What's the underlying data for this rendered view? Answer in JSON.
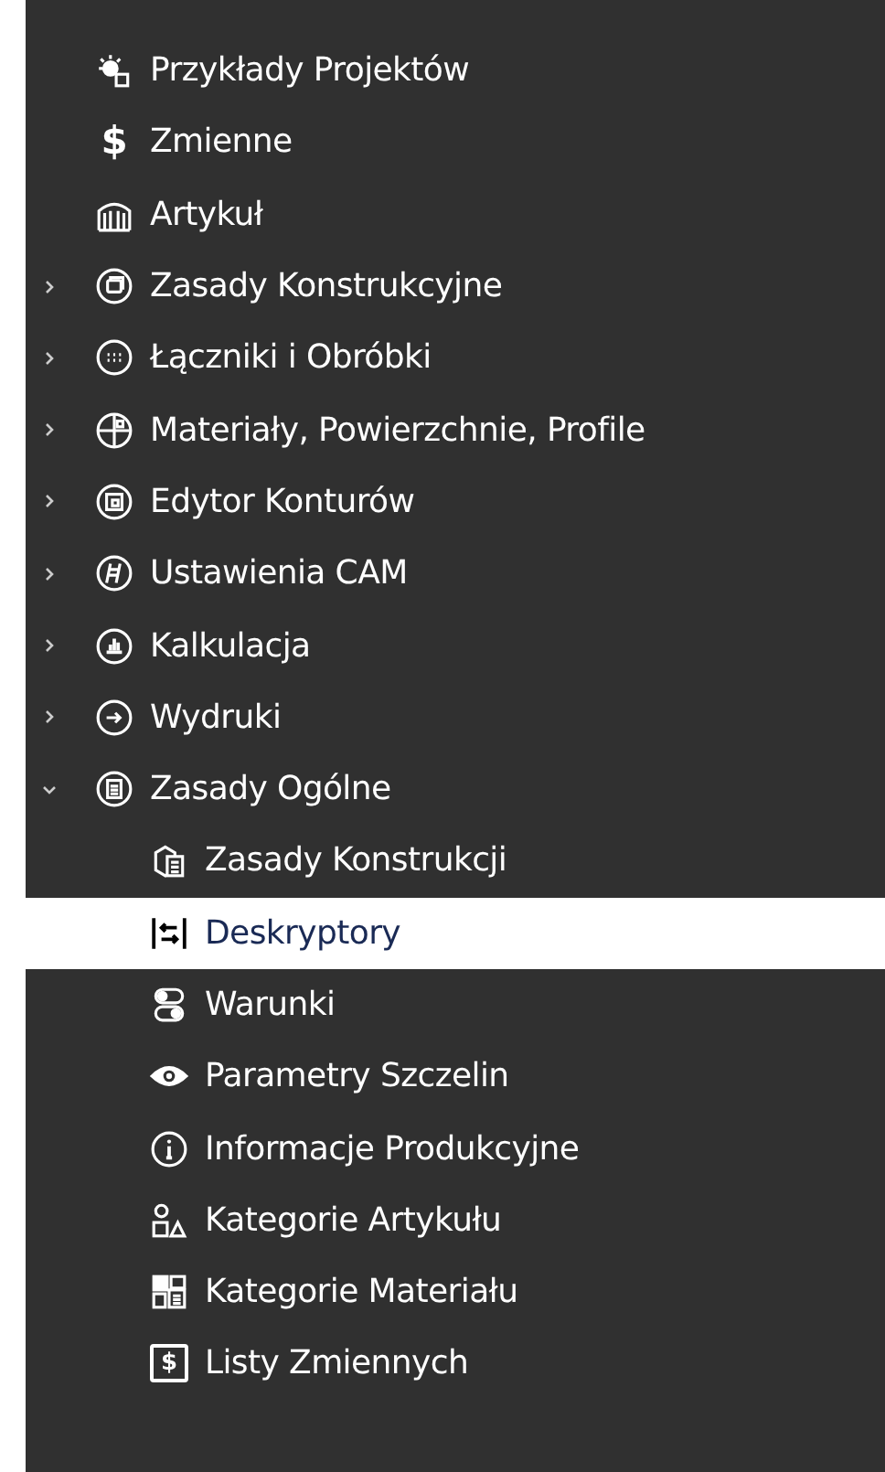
{
  "tree": [
    {
      "label": "Przykłady Projektów",
      "kind": "leaf",
      "selected": false
    },
    {
      "label": "Zmienne",
      "kind": "leaf",
      "selected": false,
      "icon_text": "$"
    },
    {
      "label": "Artykuł",
      "kind": "leaf",
      "selected": false
    },
    {
      "label": "Zasady Konstrukcyjne",
      "kind": "group",
      "expanded": false,
      "selected": false
    },
    {
      "label": "Łączniki i Obróbki",
      "kind": "group",
      "expanded": false,
      "selected": false
    },
    {
      "label": "Materiały, Powierzchnie, Profile",
      "kind": "group",
      "expanded": false,
      "selected": false
    },
    {
      "label": "Edytor Konturów",
      "kind": "group",
      "expanded": false,
      "selected": false
    },
    {
      "label": "Ustawienia CAM",
      "kind": "group",
      "expanded": false,
      "selected": false
    },
    {
      "label": "Kalkulacja",
      "kind": "group",
      "expanded": false,
      "selected": false
    },
    {
      "label": "Wydruki",
      "kind": "group",
      "expanded": false,
      "selected": false
    },
    {
      "label": "Zasady Ogólne",
      "kind": "group",
      "expanded": true,
      "selected": false,
      "children": [
        {
          "label": "Zasady Konstrukcji",
          "selected": false
        },
        {
          "label": "Deskryptory",
          "selected": true
        },
        {
          "label": "Warunki",
          "selected": false
        },
        {
          "label": "Parametry Szczelin",
          "selected": false
        },
        {
          "label": "Informacje Produkcyjne",
          "selected": false
        },
        {
          "label": "Kategorie Artykułu",
          "selected": false
        },
        {
          "label": "Kategorie Materiału",
          "selected": false
        },
        {
          "label": "Listy Zmiennych",
          "selected": false,
          "icon_text": "$"
        }
      ]
    }
  ]
}
